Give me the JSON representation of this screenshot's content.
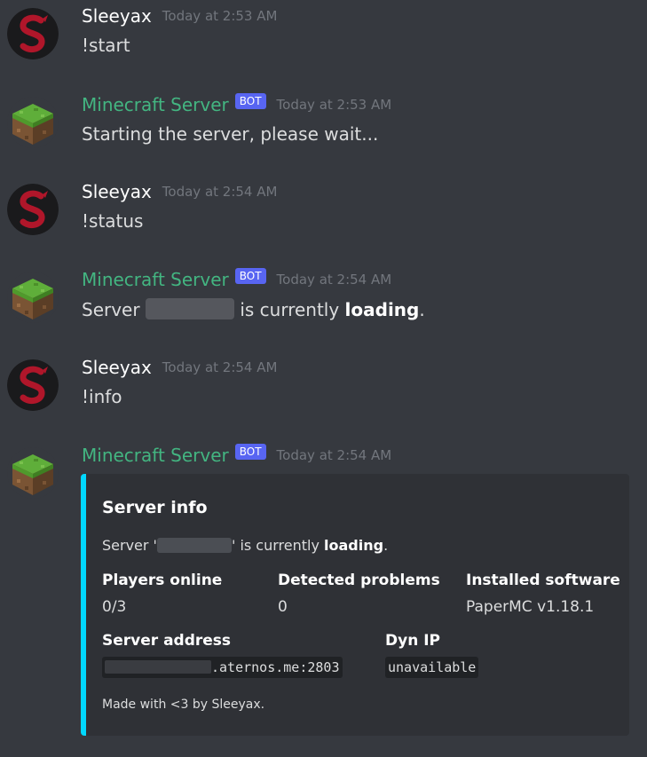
{
  "messages": [
    {
      "author": "Sleeyax",
      "timestamp": "Today at 2:53 AM",
      "text": "!start"
    },
    {
      "author": "Minecraft Server",
      "bot_tag": "BOT",
      "timestamp": "Today at 2:53 AM",
      "text": "Starting the server, please wait..."
    },
    {
      "author": "Sleeyax",
      "timestamp": "Today at 2:54 AM",
      "text": "!status"
    },
    {
      "author": "Minecraft Server",
      "bot_tag": "BOT",
      "timestamp": "Today at 2:54 AM",
      "text_prefix": "Server",
      "text_middle": "is currently",
      "text_bold": "loading",
      "text_suffix": "."
    },
    {
      "author": "Sleeyax",
      "timestamp": "Today at 2:54 AM",
      "text": "!info"
    },
    {
      "author": "Minecraft Server",
      "bot_tag": "BOT",
      "timestamp": "Today at 2:54 AM"
    }
  ],
  "embed": {
    "title": "Server info",
    "desc_prefix": "Server '",
    "desc_middle": "' is currently",
    "desc_bold": "loading",
    "desc_suffix": ".",
    "accent_color": "#00d8ff",
    "fields": {
      "players_name": "Players online",
      "players_value": "0/3",
      "problems_name": "Detected problems",
      "problems_value": "0",
      "software_name": "Installed software",
      "software_value": "PaperMC v1.18.1",
      "address_name": "Server address",
      "address_value": ".aternos.me:2803",
      "dynip_name": "Dyn IP",
      "dynip_value": "unavailable"
    },
    "footer": "Made with <3 by Sleeyax."
  },
  "colors": {
    "background": "#36393f",
    "bot_name": "#43b581",
    "bot_tag": "#5865f2",
    "embed_bg": "#2f3136"
  }
}
